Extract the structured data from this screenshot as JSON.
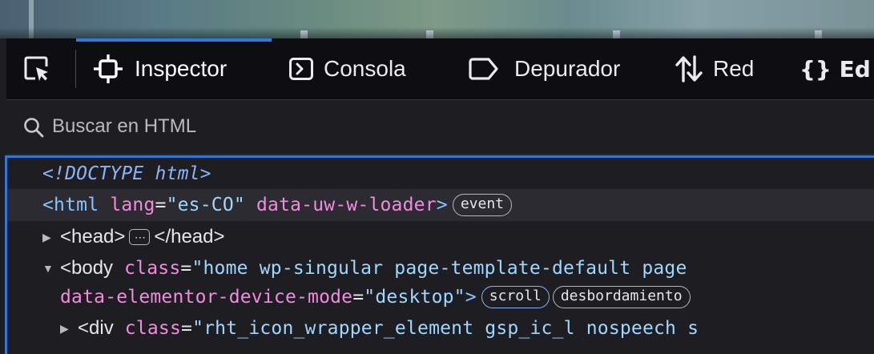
{
  "toolbar": {
    "tabs": [
      {
        "label": "Inspector",
        "icon": "inspector-target-icon"
      },
      {
        "label": "Consola",
        "icon": "console-icon"
      },
      {
        "label": "Depurador",
        "icon": "debugger-icon"
      },
      {
        "label": "Red",
        "icon": "network-arrows-icon"
      },
      {
        "label": "{} Ed",
        "icon": "style-editor-icon"
      }
    ],
    "picker_icon": "element-picker-icon",
    "active_tab": "Inspector",
    "accent_color": "#2f7bdc"
  },
  "search": {
    "placeholder": "Buscar en HTML",
    "icon": "search-icon"
  },
  "markup": {
    "line1": {
      "doctype": "<!DOCTYPE html>"
    },
    "line2": {
      "open": "<html",
      "attr1": "lang",
      "eq1": "=",
      "val1": "\"es-CO\"",
      "attr2": "data-uw-w-loader",
      "close": ">",
      "badge": "event"
    },
    "line3": {
      "open": "<head>",
      "ellipsis": "⋯",
      "close": "</head>"
    },
    "line4": {
      "open": "<body",
      "attr1": "class",
      "eq1": "=",
      "val1": "\"home wp-singular page-template-default page"
    },
    "line5": {
      "attr1": "data-elementor-device-mode",
      "eq1": "=",
      "val1": "\"desktop\"",
      "close": ">",
      "badge1": "scroll",
      "badge2": "desbordamiento"
    },
    "line6": {
      "open": "<div",
      "attr1": "class",
      "eq1": "=",
      "val1": "\"rht_icon_wrapper_element gsp_ic_l nospeech s"
    }
  }
}
